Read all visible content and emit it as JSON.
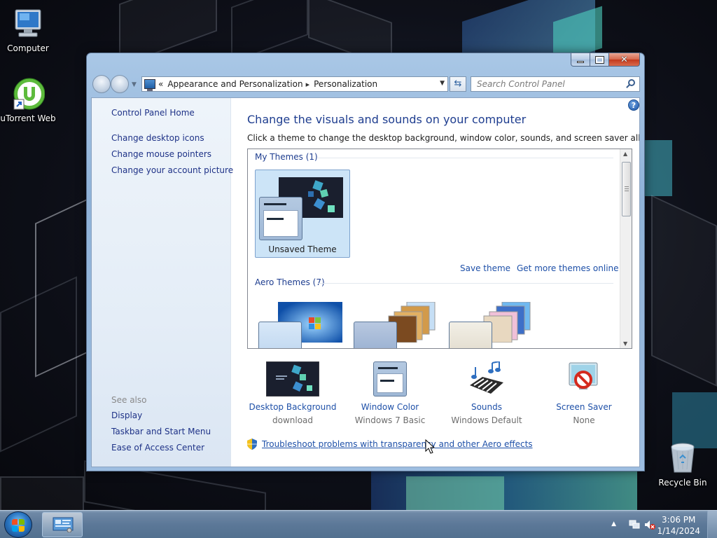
{
  "desktop": {
    "icons": [
      {
        "label": "Computer"
      },
      {
        "label": "uTorrent Web"
      },
      {
        "label": "Recycle Bin"
      }
    ]
  },
  "navbar": {
    "breadcrumb_overflow": "«",
    "breadcrumbs": [
      "Appearance and Personalization",
      "Personalization"
    ],
    "search_placeholder": "Search Control Panel"
  },
  "left_pane": {
    "home": "Control Panel Home",
    "tasks": [
      "Change desktop icons",
      "Change mouse pointers",
      "Change your account picture"
    ],
    "see_also_title": "See also",
    "see_also": [
      "Display",
      "Taskbar and Start Menu",
      "Ease of Access Center"
    ]
  },
  "main": {
    "title": "Change the visuals and sounds on your computer",
    "description": "Click a theme to change the desktop background, window color, sounds, and screen saver all at once.",
    "my_themes_title": "My Themes (1)",
    "my_themes": [
      {
        "name": "Unsaved Theme",
        "selected": true
      }
    ],
    "save_theme": "Save theme",
    "get_more": "Get more themes online",
    "aero_themes_title": "Aero Themes (7)",
    "aero_themes_visible": 3
  },
  "settings": [
    {
      "label": "Desktop Background",
      "value": "download",
      "icon": "desktop-background-icon"
    },
    {
      "label": "Window Color",
      "value": "Windows 7 Basic",
      "icon": "window-color-icon"
    },
    {
      "label": "Sounds",
      "value": "Windows Default",
      "icon": "sounds-icon"
    },
    {
      "label": "Screen Saver",
      "value": "None",
      "icon": "screen-saver-icon"
    }
  ],
  "troubleshoot": "Troubleshoot problems with transparency and other Aero effects",
  "taskbar": {
    "time": "3:06 PM",
    "date": "1/14/2024"
  },
  "colors": {
    "link": "#1e50a8",
    "heading": "#1e3d8f",
    "selection": "#cce4f7"
  }
}
